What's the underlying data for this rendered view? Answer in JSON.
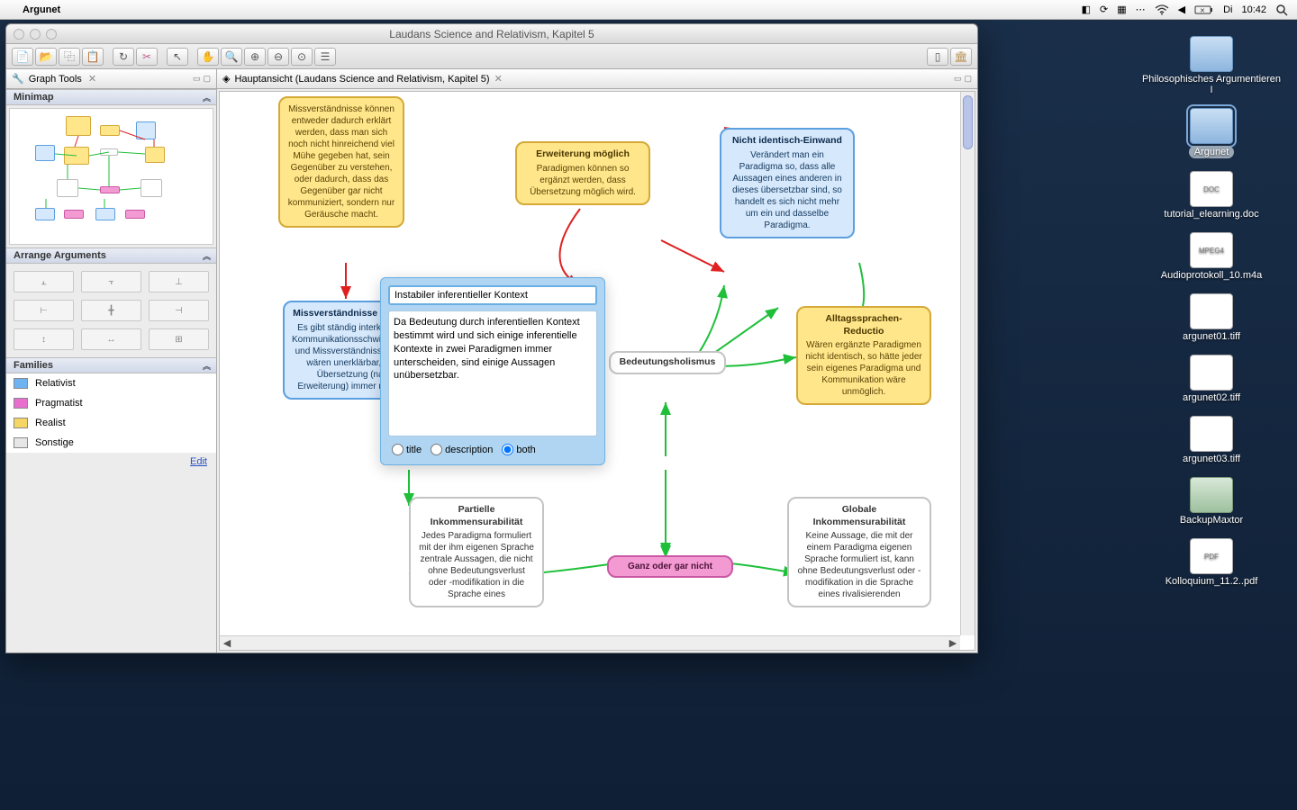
{
  "menubar": {
    "app": "Argunet",
    "day": "Di",
    "time": "10:42"
  },
  "window": {
    "title": "Laudans Science and Relativism, Kapitel 5"
  },
  "sidebar": {
    "tab": "Graph Tools",
    "sections": {
      "minimap": "Minimap",
      "arrange": "Arrange Arguments",
      "families": "Families"
    },
    "families": [
      {
        "name": "Relativist",
        "color": "#6db3f2"
      },
      {
        "name": "Pragmatist",
        "color": "#e86fce"
      },
      {
        "name": "Realist",
        "color": "#f5d563"
      },
      {
        "name": "Sonstige",
        "color": "#e6e6e6"
      }
    ],
    "edit": "Edit"
  },
  "main_tab": "Hauptansicht (Laudans Science and Relativism, Kapitel 5)",
  "editor": {
    "title": "Instabiler inferentieller Kontext",
    "body": "Da Bedeutung durch inferentiellen Kontext bestimmt wird und sich einige inferentielle Kontexte in zwei Paradigmen immer unterscheiden, sind einige Aussagen unübersetzbar.",
    "radio_title": "title",
    "radio_desc": "description",
    "radio_both": "both",
    "selected": "both"
  },
  "nodes": {
    "missv_long": "Missverständnisse können entweder dadurch erklärt werden, dass man sich noch nicht hinreichend viel Mühe gegeben hat, sein Gegenüber zu verstehen, oder dadurch, dass das Gegenüber gar nicht kommuniziert, sondern nur Geräusche macht.",
    "erweit_t": "Erweiterung möglich",
    "erweit_b": "Paradigmen können so ergänzt werden, dass Übersetzung möglich wird.",
    "nident_t": "Nicht identisch-Einwand",
    "nident_b": "Verändert man ein Paradigma so, dass alle Aussagen eines anderen in dieses übersetzbar sind, so handelt es sich nicht mehr um ein und dasselbe Paradigma.",
    "missv_erk_t": "Missverständnisse erklären",
    "missv_erk_b": "Es gibt ständig interkulturelle Kommunikationsschwierigkeiten und Missverständnisse. Diese wären unerklärbar, wäre Übersetzung (nach Erweiterung) immer möglich.",
    "bedeut": "Bedeutungsholismus",
    "alltag_t": "Alltagssprachen-Reductio",
    "alltag_b": "Wären ergänzte Paradigmen nicht identisch, so hätte jeder sein eigenes Paradigma und Kommunikation wäre unmöglich.",
    "part_t": "Partielle Inkommensurabilität",
    "part_b": "Jedes Paradigma formuliert mit der ihm eigenen Sprache zentrale Aussagen, die nicht ohne Bedeutungsverlust oder -modifikation in die Sprache eines",
    "ganz": "Ganz oder gar nicht",
    "glob_t": "Globale Inkommensurabilität",
    "glob_b": "Keine Aussage, die mit der einem Paradigma eigenen Sprache formuliert ist, kann ohne Bedeutungsverlust oder -modifikation in die Sprache eines rivalisierenden"
  },
  "desktop": [
    {
      "label": "Philosophisches Argumentieren I",
      "type": "folder"
    },
    {
      "label": "Argunet",
      "type": "folder",
      "selected": true
    },
    {
      "label": "tutorial_elearning.doc",
      "type": "doc"
    },
    {
      "label": "Audioprotokoll_10.m4a",
      "type": "doc"
    },
    {
      "label": "argunet01.tiff",
      "type": "img"
    },
    {
      "label": "argunet02.tiff",
      "type": "img"
    },
    {
      "label": "argunet03.tiff",
      "type": "img"
    },
    {
      "label": "BackupMaxtor",
      "type": "hd"
    },
    {
      "label": "Kolloquium_11.2..pdf",
      "type": "doc"
    }
  ]
}
